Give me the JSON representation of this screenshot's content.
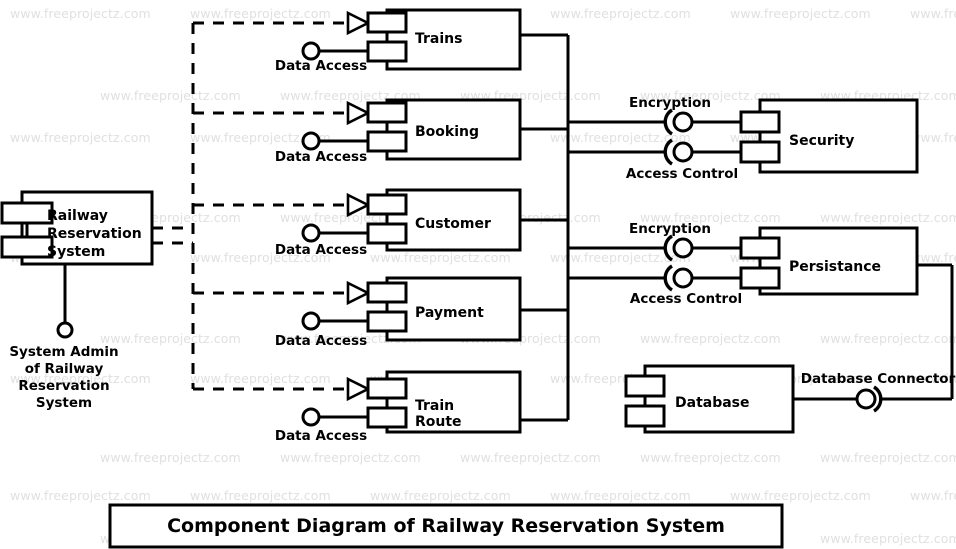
{
  "diagram": {
    "title": "Component Diagram of Railway Reservation System",
    "watermark_text": "www.freeprojectz.com",
    "colors": {
      "stroke": "#000000",
      "fill": "#ffffff",
      "watermark": "#e0e0e0",
      "background": "#ffffff"
    }
  },
  "actor": {
    "component_label_line1": "Railway",
    "component_label_line2": "Reservation",
    "component_label_line3": "System",
    "interface_label_line1": "System Admin",
    "interface_label_line2": "of Railway",
    "interface_label_line3": "Reservation",
    "interface_label_line4": "System"
  },
  "components": [
    {
      "id": "trains",
      "label_line1": "Trains",
      "label_line2": "",
      "required_interface": "Data Access"
    },
    {
      "id": "booking",
      "label_line1": "Booking",
      "label_line2": "",
      "required_interface": "Data Access"
    },
    {
      "id": "customer",
      "label_line1": "Customer",
      "label_line2": "",
      "required_interface": "Data Access"
    },
    {
      "id": "payment",
      "label_line1": "Payment",
      "label_line2": "",
      "required_interface": "Data Access"
    },
    {
      "id": "train-route",
      "label_line1": "Train",
      "label_line2": "Route",
      "required_interface": "Data Access"
    }
  ],
  "service_components": [
    {
      "id": "security",
      "label": "Security",
      "interface_top": "Encryption",
      "interface_bottom": "Access Control"
    },
    {
      "id": "persistance",
      "label": "Persistance",
      "interface_top": "Encryption",
      "interface_bottom": "Access Control"
    }
  ],
  "database": {
    "label": "Database",
    "connector_label": "Database Connector"
  }
}
